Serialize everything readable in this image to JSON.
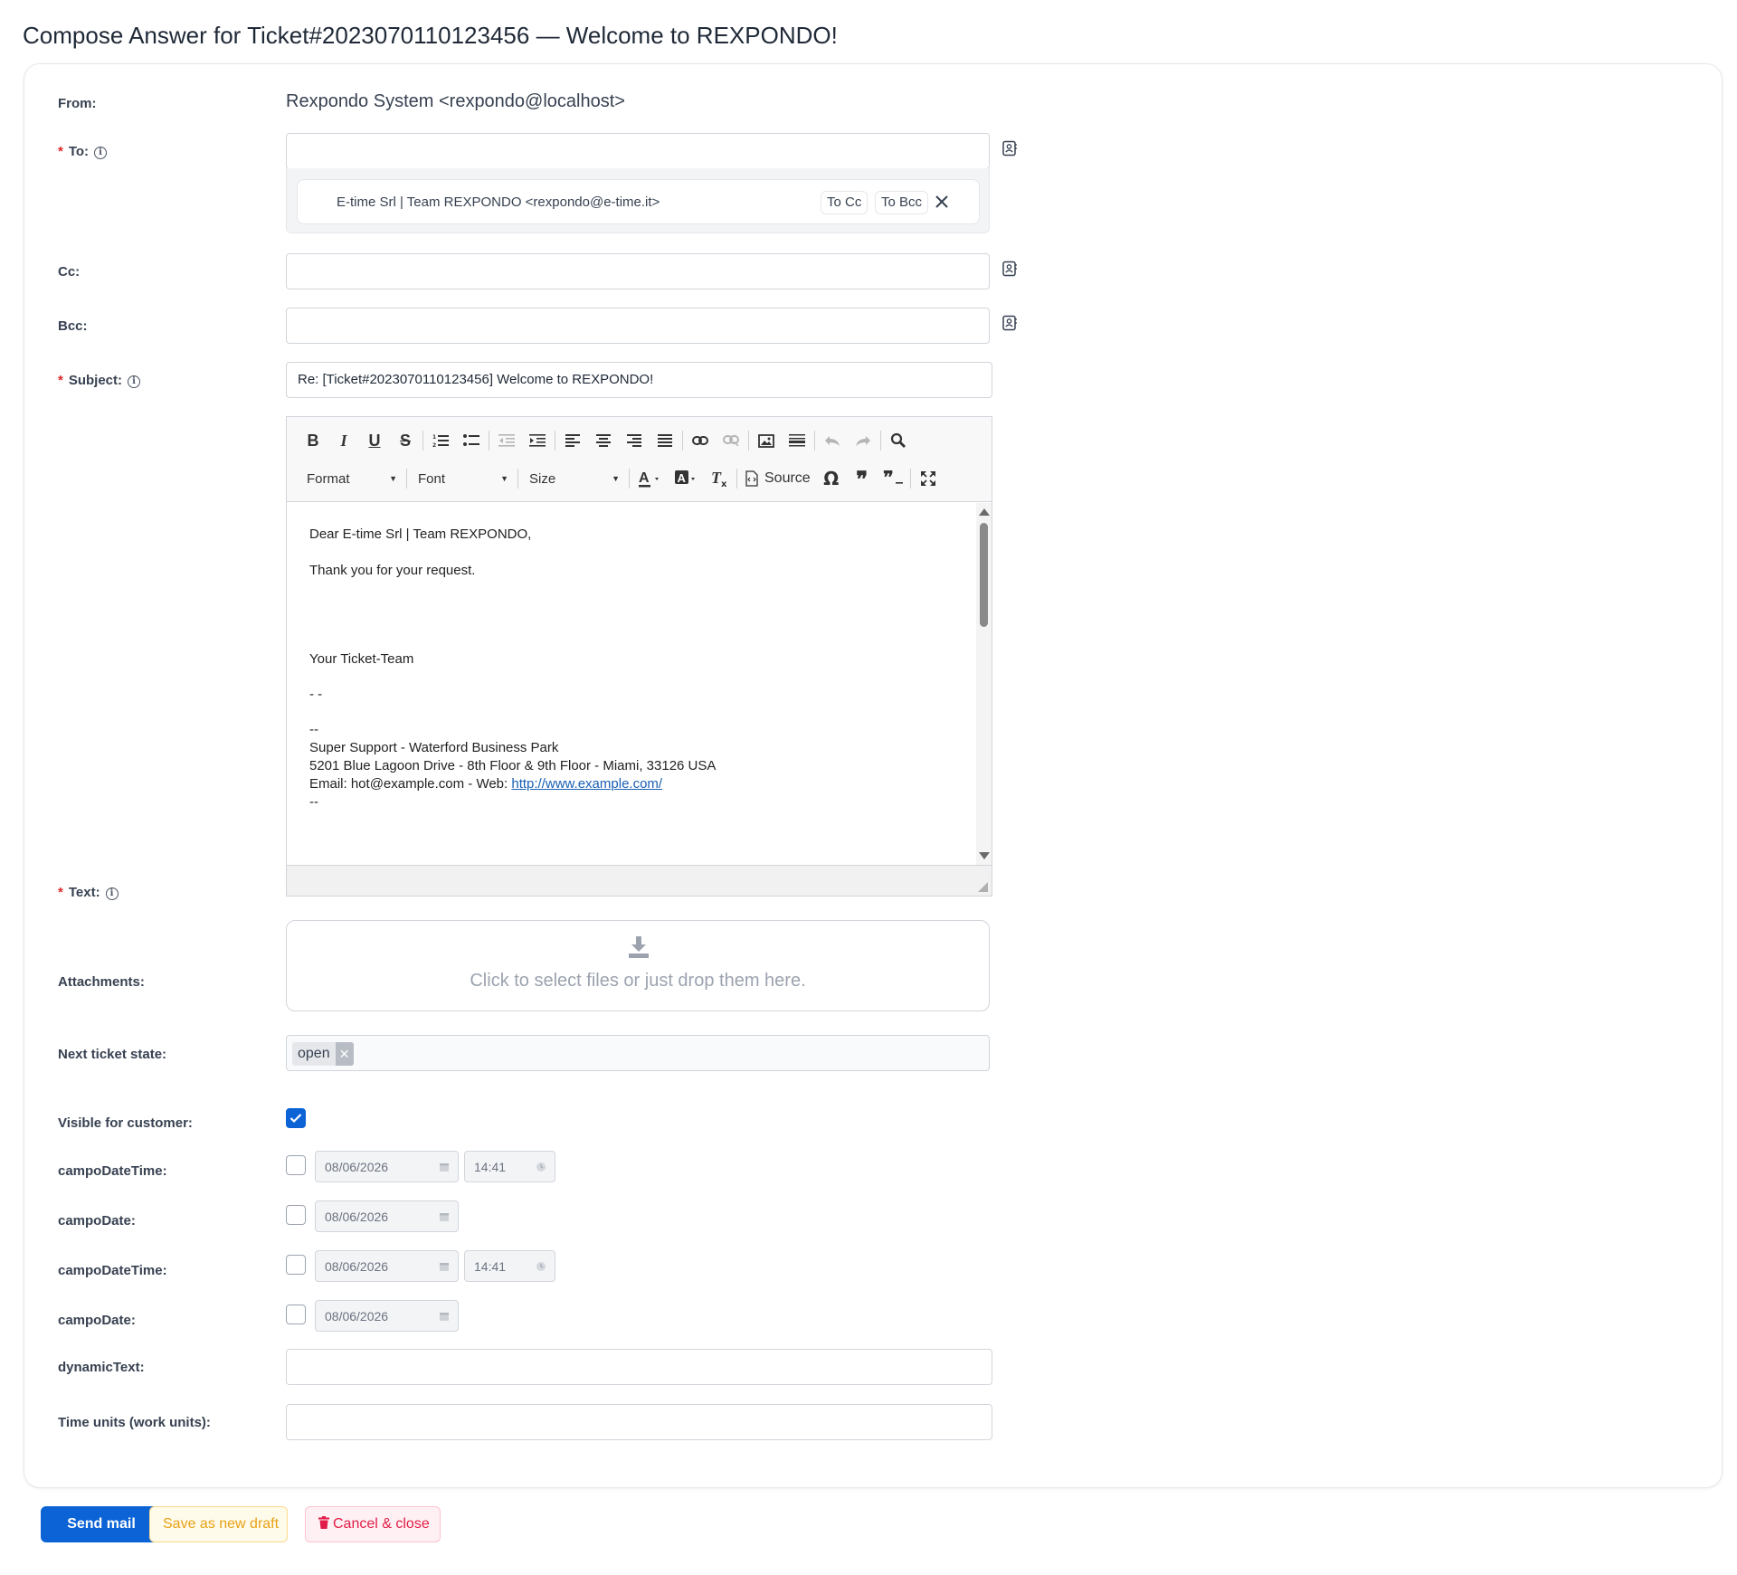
{
  "page": {
    "title": "Compose Answer for Ticket#2023070110123456 — Welcome to REXPONDO!"
  },
  "form": {
    "from": {
      "label": "From:",
      "value": "Rexpondo System <rexpondo@localhost>"
    },
    "to": {
      "label": "To:",
      "value": "",
      "recipient": {
        "name": "E-time Srl | Team REXPONDO <rexpondo@e-time.it>",
        "to_cc_label": "To Cc",
        "to_bcc_label": "To Bcc"
      }
    },
    "cc": {
      "label": "Cc:",
      "value": ""
    },
    "bcc": {
      "label": "Bcc:",
      "value": ""
    },
    "subject": {
      "label": "Subject:",
      "value": "Re: [Ticket#2023070110123456] Welcome to REXPONDO!"
    },
    "text": {
      "label": "Text:",
      "toolbar": {
        "format_label": "Format",
        "font_label": "Font",
        "size_label": "Size",
        "source_label": "Source"
      },
      "body": {
        "greeting": "Dear E-time Srl | Team REXPONDO,",
        "thanks": "Thank you for your request.",
        "signoff": "Your Ticket-Team",
        "dashes1": "- -",
        "dashes2": "--",
        "sig_line1": "Super Support - Waterford Business Park",
        "sig_line2": "5201 Blue Lagoon Drive - 8th Floor & 9th Floor - Miami, 33126 USA",
        "sig_line3_prefix": "Email: hot@example.com - Web: ",
        "sig_link": "http://www.example.com/",
        "dashes3": "--"
      }
    },
    "attachments": {
      "label": "Attachments:",
      "placeholder": "Click to select files or just drop them here."
    },
    "next_state": {
      "label": "Next ticket state:",
      "value": "open"
    },
    "visible_for_customer": {
      "label": "Visible for customer:",
      "checked": true
    },
    "custom_fields": [
      {
        "label": "campoDateTime:",
        "date": "08/06/2026",
        "time": "14:41",
        "checked": false
      },
      {
        "label": "campoDate:",
        "date": "08/06/2026",
        "checked": false
      },
      {
        "label": "campoDateTime:",
        "date": "08/06/2026",
        "time": "14:41",
        "checked": false
      },
      {
        "label": "campoDate:",
        "date": "08/06/2026",
        "checked": false
      }
    ],
    "dynamic_text": {
      "label": "dynamicText:",
      "value": ""
    },
    "time_units": {
      "label": "Time units (work units):",
      "value": ""
    }
  },
  "actions": {
    "send_label": "Send mail",
    "draft_label": "Save as new draft",
    "cancel_label": "Cancel & close"
  },
  "colors": {
    "primary": "#0b63d6",
    "warning": "#e6a117",
    "danger": "#e11d48",
    "required": "#dc2626"
  }
}
